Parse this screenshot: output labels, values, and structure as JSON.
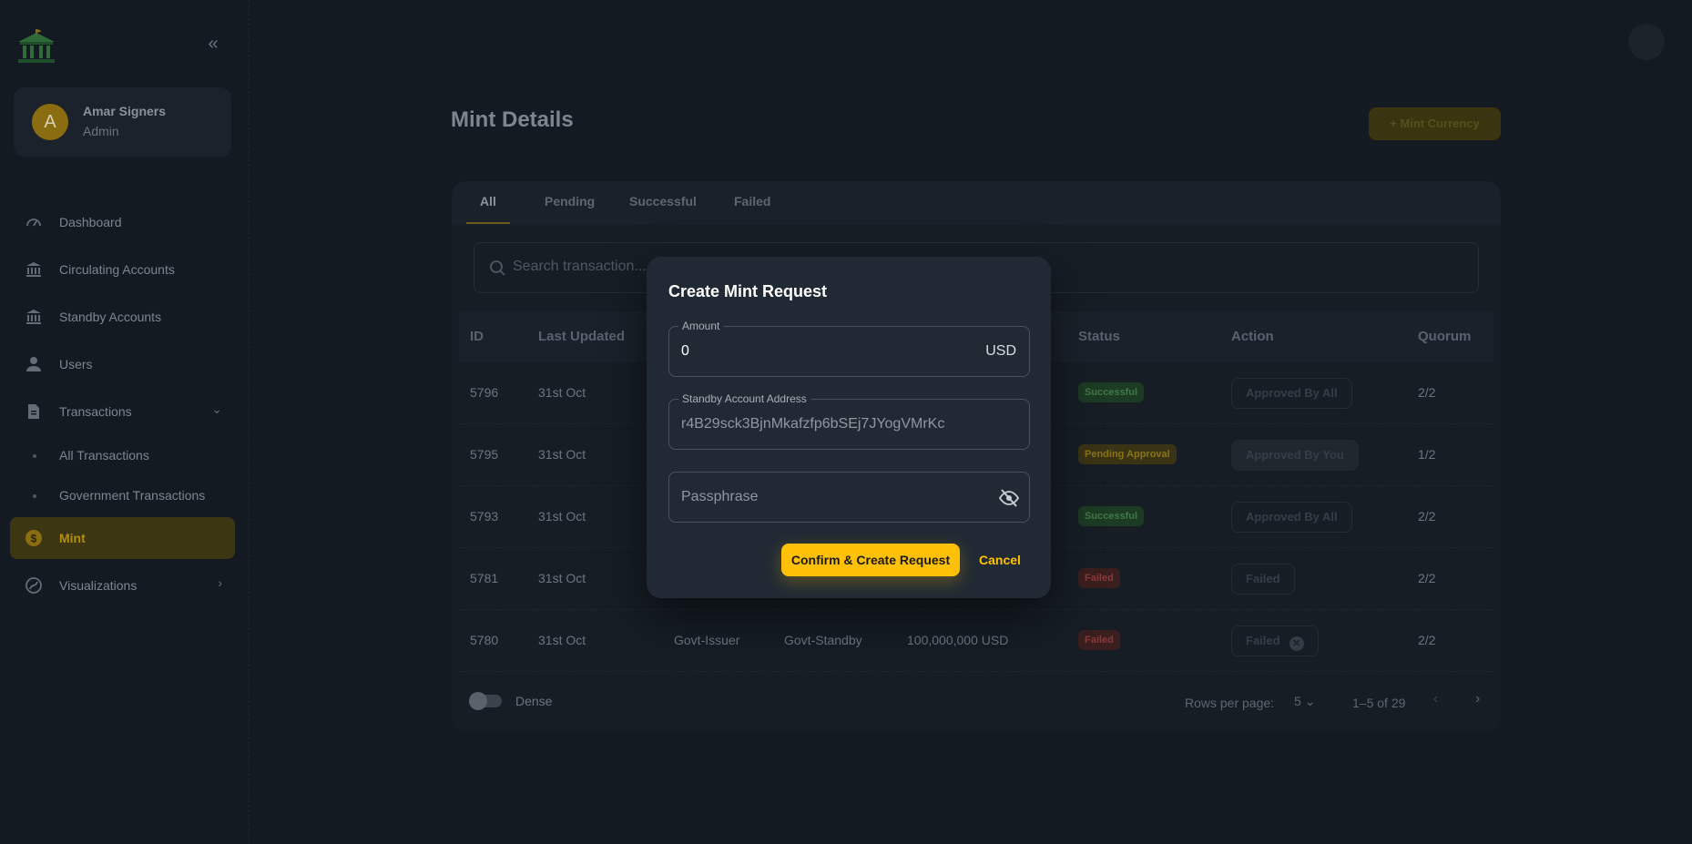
{
  "app": {
    "accent": "#ffc107",
    "logo_icon": "bank-building-icon"
  },
  "user": {
    "initial": "A",
    "name": "Amar Signers",
    "role": "Admin"
  },
  "sidebar": {
    "items": [
      {
        "label": "Dashboard",
        "icon": "speedometer-icon"
      },
      {
        "label": "Circulating Accounts",
        "icon": "bank-icon"
      },
      {
        "label": "Standby Accounts",
        "icon": "bank-icon"
      },
      {
        "label": "Users",
        "icon": "user-icon"
      },
      {
        "label": "Transactions",
        "icon": "document-icon"
      },
      {
        "label": "Mint",
        "icon": "coin-icon"
      },
      {
        "label": "Visualizations",
        "icon": "chart-icon"
      }
    ],
    "sub_items": [
      {
        "label": "All Transactions"
      },
      {
        "label": "Government Transactions"
      }
    ]
  },
  "page": {
    "title": "Mint Details",
    "mint_button": "+ Mint Currency"
  },
  "tabs": [
    "All",
    "Pending",
    "Successful",
    "Failed"
  ],
  "search": {
    "placeholder": "Search transaction..."
  },
  "table": {
    "headers": {
      "id": "ID",
      "updated": "Last Updated",
      "status": "Status",
      "action": "Action",
      "quorum": "Quorum"
    },
    "rows": [
      {
        "id": "5796",
        "date": "31st Oct",
        "from": "",
        "to": "",
        "amount": "",
        "status": "Successful",
        "action": "Approved By All",
        "quorum": "2/2"
      },
      {
        "id": "5795",
        "date": "31st Oct",
        "from": "",
        "to": "",
        "amount": "",
        "status": "Pending Approval",
        "action": "Approved By You",
        "quorum": "1/2"
      },
      {
        "id": "5793",
        "date": "31st Oct",
        "from": "",
        "to": "",
        "amount": "",
        "status": "Successful",
        "action": "Approved By All",
        "quorum": "2/2"
      },
      {
        "id": "5781",
        "date": "31st Oct",
        "from": "",
        "to": "",
        "amount": "",
        "status": "Failed",
        "action": "Failed",
        "quorum": "2/2"
      },
      {
        "id": "5780",
        "date": "31st Oct",
        "from": "Govt-Issuer",
        "to": "Govt-Standby",
        "amount": "100,000,000 USD",
        "status": "Failed",
        "action": "Failed",
        "quorum": "2/2"
      }
    ]
  },
  "footer": {
    "dense_label": "Dense",
    "rows_per_page_label": "Rows per page:",
    "rows_per_page": "5",
    "range": "1–5 of 29"
  },
  "modal": {
    "title": "Create Mint Request",
    "amount": {
      "label": "Amount",
      "value": "0",
      "unit": "USD"
    },
    "standby_address": {
      "label": "Standby Account Address",
      "value": "r4B29sck3BjnMkafzfp6bSEj7JYogVMrKc"
    },
    "passphrase": {
      "placeholder": "Passphrase"
    },
    "confirm_label": "Confirm & Create Request",
    "cancel_label": "Cancel"
  }
}
